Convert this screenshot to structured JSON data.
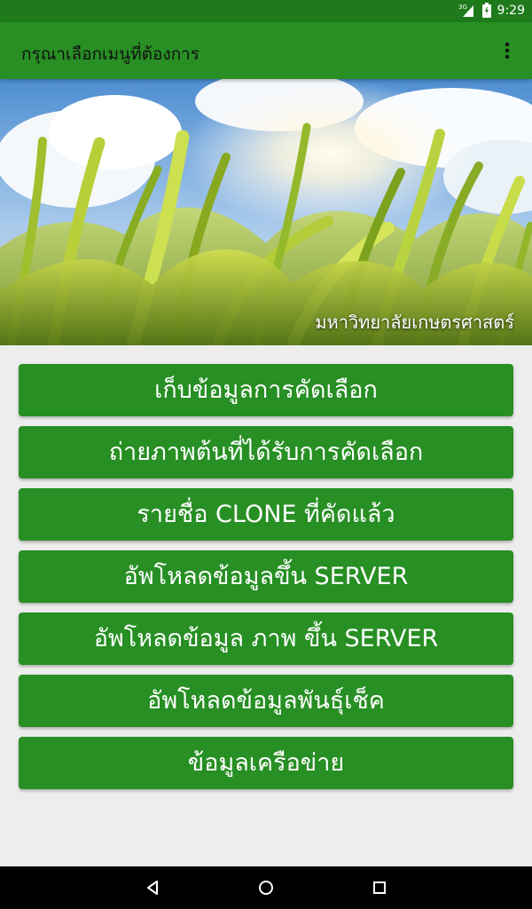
{
  "status_bar": {
    "network": "3G",
    "time": "9:29"
  },
  "app_bar": {
    "title": "กรุณาเลือกเมนูที่ต้องการ",
    "overflow_icon": "more-vert-icon"
  },
  "hero": {
    "caption": "มหาวิทยาลัยเกษตรศาสตร์"
  },
  "menu": {
    "items": [
      {
        "label": "เก็บข้อมูลการคัดเลือก"
      },
      {
        "label": "ถ่ายภาพต้นที่ได้รับการคัดเลือก"
      },
      {
        "label": "รายชื่อ CLONE ที่คัดแล้ว"
      },
      {
        "label": "อัพโหลดข้อมูลขึ้น SERVER"
      },
      {
        "label": "อัพโหลดข้อมูล ภาพ ขึ้น SERVER"
      },
      {
        "label": "อัพโหลดข้อมูลพันธุ์เช็ค"
      },
      {
        "label": "ข้อมูลเครือข่าย"
      }
    ]
  },
  "navigation": {
    "back_icon": "back-icon",
    "home_icon": "home-icon",
    "recents_icon": "recents-icon"
  },
  "colors": {
    "primary": "#278f23",
    "status": "#1f7a1b",
    "background": "#ededed"
  }
}
